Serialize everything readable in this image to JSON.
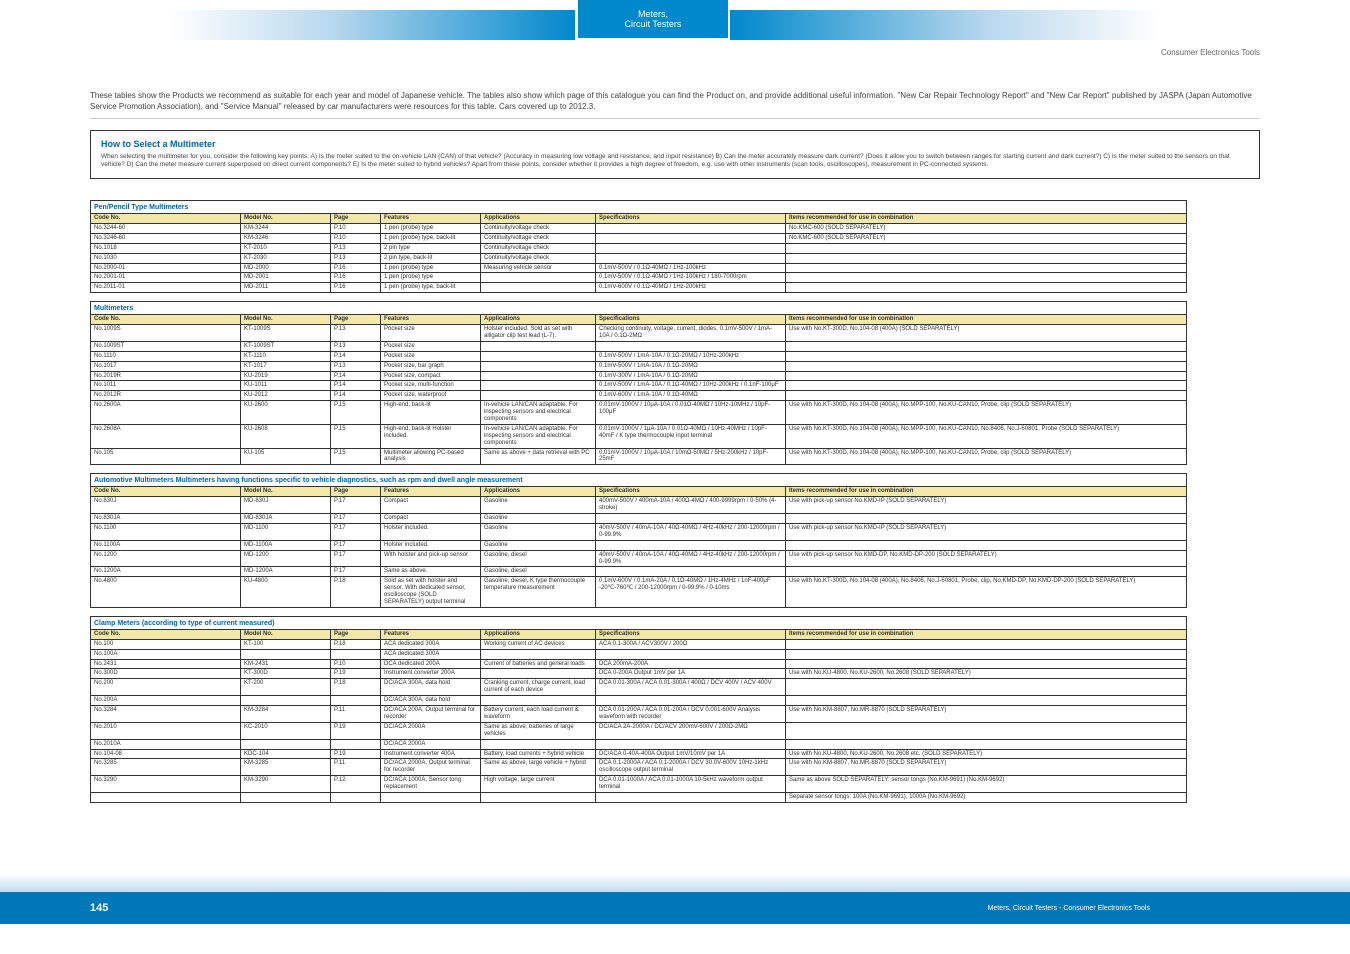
{
  "header": {
    "tab_line1": "Meters,",
    "tab_line2": "Circuit Testers",
    "right_title": "Consumer Electronics Tools"
  },
  "intro": "These tables show the Products we recommend as suitable for each year and model of Japanese vehicle. The tables also show which page of this catalogue you can find the Product on, and provide additional useful information. \"New Car Repair Technology Report\" and \"New Car Report\" published by JASPA (Japan Automotive Service Promotion Association), and \"Service Manual\" released by car manufacturers were resources for this table. Cars covered up to 2012.3.",
  "box": {
    "title": "How to Select a Multimeter",
    "body": "When selecting the multimeter for you, consider the following key points: A) Is the meter suited to the on-vehicle LAN (CAN) of that vehicle? (Accuracy in measuring low voltage and resistance, and input resistance) B) Can the meter accurately measure dark current? (Does it allow you to switch between ranges for starting current and dark current?) C) Is the meter suited to the sensors on that vehicle? D) Can the meter measure current superposed on direct current components? E) Is the meter suited to hybrid vehicles? Apart from these points, consider whether it provides a high degree of freedom, e.g. use with other instruments (scan tools, oscilloscopes), measurement in PC-connected systems."
  },
  "columns": [
    "Code No.",
    "Model No.",
    "Page",
    "Features",
    "Applications",
    "Specifications",
    "Items recommended for use in combination"
  ],
  "sections": [
    {
      "title": "Pen/Pencil Type Multimeters",
      "rows": [
        {
          "code": "No.3244-60",
          "model": "KM-3244",
          "page": "P.10",
          "feat": "1 pen (probe) type",
          "app": "Continuity/voltage check",
          "specs": "",
          "rec": "No.KMC-600 (SOLD SEPARATELY)"
        },
        {
          "code": "No.3246-60",
          "model": "KM-3246",
          "page": "P.10",
          "feat": "1 pen (probe) type, back-lit",
          "app": "Continuity/voltage check",
          "specs": "",
          "rec": "No.KMC-600 (SOLD SEPARATELY)"
        },
        {
          "code": "No.1018",
          "model": "KT-2010",
          "page": "P.13",
          "feat": "2 pin type",
          "app": "Continuity/voltage check",
          "specs": "",
          "rec": ""
        },
        {
          "code": "No.1030",
          "model": "KT-2030",
          "page": "P.13",
          "feat": "2 pin type, back-lit",
          "app": "Continuity/voltage check",
          "specs": "",
          "rec": ""
        },
        {
          "code": "No.2000-01",
          "model": "MD-2000",
          "page": "P.16",
          "feat": "1 pen (probe) type",
          "app2": "Measuring vehicle sensor",
          "specs": "0.1mV-500V / 0.1Ω-40MΩ / 1Hz-100kHz",
          "rec": ""
        },
        {
          "code": "No.2001-01",
          "model": "MD-2001",
          "page": "P.16",
          "feat": "1 pen (probe) type",
          "specs": "0.1mV-500V / 0.1Ω-40MΩ / 1Hz-100kHz / 180-7000rpm",
          "rec": ""
        },
        {
          "code": "No.2011-01",
          "model": "MD-2011",
          "page": "P.16",
          "feat": "1 pen (probe) type, back-lit",
          "specs": "0.1mV-600V / 0.1Ω-40MΩ / 1Hz-200kHz",
          "rec": ""
        }
      ]
    },
    {
      "title": "Multimeters",
      "rows": [
        {
          "code": "No.1009S",
          "model": "KT-1009S",
          "page": "P.13",
          "feat": "Pocket size",
          "app": "Holster included. Sold as set with alligator clip test lead (L-7).",
          "specs": "Checking continuity, voltage, current, diodes. 0.1mV-500V / 1mA-10A / 0.1Ω-2MΩ",
          "rec": "Use with No.KT-300D, No.104-08 (400A) (SOLD SEPARATELY)"
        },
        {
          "code": "No.1009ST",
          "model": "KT-1009ST",
          "page": "P.13",
          "feat": "Pocket size",
          "app": "",
          "specs": "",
          "rec": ""
        },
        {
          "code": "No.1110",
          "model": "KT-1110",
          "page": "P.14",
          "feat": "Pocket size",
          "app": "",
          "specs": "0.1mV-500V / 1mA-10A / 0.1Ω-20MΩ / 10Hz-200kHz",
          "rec": ""
        },
        {
          "code": "No.1017",
          "model": "KT-1017",
          "page": "P.13",
          "feat": "Pocket size, bar graph",
          "app": "",
          "specs": "0.1mV-500V / 1mA-10A / 0.1Ω-20MΩ",
          "rec": ""
        },
        {
          "code": "No.2019R",
          "model": "KU-2019",
          "page": "P.14",
          "feat": "Pocket size, compact",
          "app": "",
          "specs": "0.1mV-300V / 1mA-10A / 0.1Ω-20MΩ",
          "rec": ""
        },
        {
          "code": "No.1011",
          "model": "KU-1011",
          "page": "P.14",
          "feat": "Pocket size, multi-function",
          "app": "",
          "specs": "0.1mV-500V / 1mA-10A / 0.1Ω-40MΩ / 10Hz-200kHz / 0.1nF-100μF",
          "rec": ""
        },
        {
          "code": "No.2012R",
          "model": "KU-2012",
          "page": "P.14",
          "feat": "Pocket size, waterproof",
          "app": "",
          "specs": "0.1mV-600V / 1mA-10A / 0.1Ω-40MΩ",
          "rec": ""
        },
        {
          "code": "No.2600A",
          "model": "KU-2600",
          "page": "P.15",
          "feat": "High-end, back-lit",
          "app": "In-vehicle LAN/CAN adaptable. For inspecting sensors and electrical components",
          "specs": "0.01mV-1000V / 10μA-10A / 0.01Ω-40MΩ / 10Hz-10MHz / 10pF-100μF",
          "rec": "Use with No.KT-300D, No.104-08 (400A), No.MPP-100, No.KU-CAN10, Probe, clip (SOLD SEPARATELY)"
        },
        {
          "code": "No.2608A",
          "model": "KU-2608",
          "page": "P.15",
          "feat": "High-end, back-lit Holster included.",
          "app": "In-vehicle LAN/CAN adaptable. For inspecting sensors and electrical components",
          "specs": "0.01mV-1000V / 1μA-10A / 0.01Ω-40MΩ / 10Hz-40MHz / 10pF-40mF / K type thermocouple input terminal",
          "rec": "Use with No.KT-300D, No.104-08 (400A), No.MPP-100, No.KU-CAN10, No.8406, No.J-60801, Probe (SOLD SEPARATELY)"
        },
        {
          "code": "No.105",
          "model": "KU-105",
          "page": "P.15",
          "feat": "Multimeter allowing PC-based analysis",
          "app": "Same as above + data retrieval with PC",
          "specs": "0.01mV-1000V / 10μA-10A / 10mΩ-50MΩ / 5Hz-200kHz / 10pF-25mF",
          "rec": "Use with No.KT-300D, No.104-08 (400A), No.MPP-100, No.KU-CAN10, Probe, clip (SOLD SEPARATELY)"
        }
      ]
    },
    {
      "title": "Automotive Multimeters  Multimeters having functions specific to vehicle diagnostics, such as rpm and dwell angle measurement",
      "rows": [
        {
          "code": "No.830J",
          "model": "MD-830J",
          "page": "P.17",
          "feat": "Compact",
          "app": "Gasoline",
          "specs": "400mV-500V / 400mA-10A / 400Ω-4MΩ / 400-9999rpm / 0-50% (4-stroke)",
          "rec": "Use with pick-up sensor No.KMD-IP (SOLD SEPARATELY)"
        },
        {
          "code": "No.830JA",
          "model": "MD-830JA",
          "page": "P.17",
          "feat": "Compact",
          "app": "Gasoline",
          "specs": "",
          "rec": ""
        },
        {
          "code": "No.1100",
          "model": "MD-1100",
          "page": "P.17",
          "feat": "Holster included.",
          "app": "Gasoline",
          "specs": "40mV-500V / 40mA-10A / 40Ω-40MΩ / 4Hz-40kHz / 200-12000rpm / 0-99.9%",
          "rec": "Use with pick-up sensor No.KMD-IP (SOLD SEPARATELY)"
        },
        {
          "code": "No.1100A",
          "model": "MD-1100A",
          "page": "P.17",
          "feat": "Holster included.",
          "app": "Gasoline",
          "specs": "",
          "rec": ""
        },
        {
          "code": "No.1200",
          "model": "MD-1200",
          "page": "P.17",
          "feat": "With holster and pick-up sensor",
          "app": "Gasoline, diesel",
          "specs": "40mV-500V / 40mA-10A / 40Ω-40MΩ / 4Hz-40kHz / 200-12000rpm / 0-99.9%",
          "rec": "Use with pick-up sensor No.KMD-DP, No.KMD-DP-200 (SOLD SEPARATELY)"
        },
        {
          "code": "No.1200A",
          "model": "MD-1200A",
          "page": "P.17",
          "feat": "Same as above.",
          "app": "Gasoline, diesel",
          "specs": "",
          "rec": ""
        },
        {
          "code": "No.4800",
          "model": "KU-4800",
          "page": "P.18",
          "feat": "Sold as set with holster and sensor. With dedicated sensor, oscilloscope (SOLD SEPARATELY) output terminal",
          "app": "Gasoline, diesel, K type thermocouple temperature measurement",
          "specs": "0.1mV-600V / 0.1mA-20A / 0.1Ω-40MΩ / 1Hz-4MHz / 1nF-400μF -20℃-760℃ / 200-12000rpm / 0-99.9% / 0-10ms",
          "rec": "Use with No.KT-300D, No.104-08 (400A), No.8406, No.J-60801, Probe, clip, No.KMD-DP, No.KMD-DP-200 (SOLD SEPARATELY)"
        }
      ]
    },
    {
      "title": "Clamp Meters (according to type of current measured)",
      "rows": [
        {
          "code": "No.100",
          "model": "KT-100",
          "page": "P.18",
          "feat": "ACA dedicated 300A",
          "app": "Working current of AC devices",
          "specs": "ACA 0.1-300A / ACV300V / 200Ω",
          "rec": ""
        },
        {
          "code": "No.100A",
          "model": "",
          "page": "",
          "feat": "ACA dedicated 300A",
          "app": "",
          "specs": "",
          "rec": ""
        },
        {
          "code": "No.2431",
          "model": "KM-2431",
          "page": "P.10",
          "feat": "DCA dedicated 200A",
          "app": "Current of batteries and general loads",
          "specs": "DCA 200mA-200A",
          "rec": ""
        },
        {
          "code": "No.300D",
          "model": "KT-300D",
          "page": "P.19",
          "feat": "Instrument converter 200A",
          "app": "",
          "specs": "DCA 0-200A  Output 1mV per 1A",
          "rec": "Use with No.KU-4800, No.KU-2600, No.2608 (SOLD SEPARATELY)"
        },
        {
          "code": "No.200",
          "model": "KT-200",
          "page": "P.18",
          "feat": "DC/ACA 300A, data hold",
          "app": "Cranking current, charge current, load current of each device",
          "specs": "DCA 0.01-300A / ACA 0.01-300A / 400Ω / DCV 400V / ACV 400V",
          "rec": ""
        },
        {
          "code": "No.200A",
          "model": "",
          "page": "",
          "feat": "DC/ACA 300A, data hold",
          "app": "",
          "specs": "",
          "rec": ""
        },
        {
          "code": "No.3284",
          "model": "KM-3284",
          "page": "P.11",
          "feat": "DC/ACA 200A, Output terminal for recorder",
          "app": "Battery current, each load current & waveform",
          "specs": "DCA 0.01-200A / ACA 0.01-200A / DCV 0.001-600V Analysis waveform with recorder",
          "rec": "Use with No.KM-8807, No.MR-8870 (SOLD SEPARATELY)"
        },
        {
          "code": "No.2010",
          "model": "KC-2010",
          "page": "P.19",
          "feat": "DC/ACA 2000A",
          "app": "Same as above, batteries of large vehicles",
          "specs": "DC/ACA 2A-2000A / DC/ACV 200mV-600V / 200Ω-2MΩ",
          "rec": ""
        },
        {
          "code": "No.2010A",
          "model": "",
          "page": "",
          "feat": "DC/ACA 2000A",
          "app": "",
          "specs": "",
          "rec": ""
        },
        {
          "code": "No.104-08",
          "model": "KDC-104",
          "page": "P.19",
          "feat": "Instrument converter 400A",
          "app": "Battery, load currents + hybrid vehicle",
          "specs": "DC/ACA 0-40A-400A  Output 1mV/10mV per 1A",
          "rec": "Use with No.KU-4800, No.KU-2600, No.2608 etc. (SOLD SEPARATELY)"
        },
        {
          "code": "No.3285",
          "model": "KM-3285",
          "page": "P.11",
          "feat": "DC/ACA 2000A, Output terminal for recorder",
          "app": "Same as above, large vehicle + hybrid",
          "specs": "DCA 0.1-2000A / ACA 0.1-2000A / DCV 30.0V-600V 10Hz-1kHz oscilloscope output terminal",
          "rec": "Use with No.KM-8807, No.MR-8870 (SOLD SEPARATELY)"
        },
        {
          "code": "No.3290",
          "model": "KM-3290",
          "page": "P.12",
          "feat": "DC/ACA 1000A, Sensor tong replacement",
          "app": "High voltage, large current",
          "specs": "DCA 0.01-1000A / ACA 0.01-1000A 10-5kHz waveform output terminal",
          "rec": "Same as above SOLD SEPARATELY: sensor tongs (No.KM-9691) (No.KM-9692)"
        },
        {
          "code": "",
          "model": "",
          "page": "",
          "feat": "",
          "app": "",
          "specs": "",
          "rec": "Separate sensor tongs: 100A (No.KM-9691), 1000A (No.KM-9692)"
        }
      ]
    }
  ],
  "footer": {
    "page": "145",
    "text": "Meters, Circuit Testers - Consumer Electronics Tools"
  }
}
